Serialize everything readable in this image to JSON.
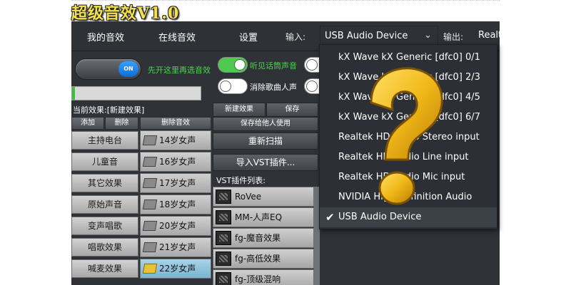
{
  "app": {
    "title": "超级音效V1.0",
    "menu": {
      "tabs": [
        "我的音效",
        "在线音效",
        "设置"
      ],
      "input_label": "输入:",
      "output_label": "输出:",
      "selected_input": "USB Audio Device",
      "output_value": "Realte"
    },
    "left_panel": {
      "toggle_state": "ON",
      "hint": "先开这里再选音效",
      "current_effect": "当前效果:[新建效果]",
      "buttons": [
        "添加",
        "删除",
        "删除音效"
      ],
      "presets": [
        "主持电台",
        "儿童音",
        "其它效果",
        "原始声音",
        "变声唱歌",
        "唱歌效果",
        "喊麦效果"
      ],
      "voices": [
        "14岁女声",
        "16岁女声",
        "17岁女声",
        "18岁女声",
        "20岁女声",
        "21岁女声",
        "22岁女声"
      ],
      "selected_voice": "22岁女声"
    },
    "toggles": [
      {
        "label": "听见话筒声音",
        "on": true
      },
      {
        "label": "消除歌曲人声",
        "on": false
      }
    ],
    "middle_panel": {
      "new_effect": "新建效果",
      "save": "保存",
      "save_for_others": "保存给他人使用",
      "rescan": "重新扫描",
      "import_vst": "导入VST插件...",
      "vst_list_label": "VST插件列表:",
      "vst_plugins": [
        "RoVee",
        "MM-人声EQ",
        "fg-魔音效果",
        "fg-高低效果",
        "fg-顶级混响"
      ]
    },
    "dropdown": {
      "options": [
        "kX Wave kX Generic [dfc0] 0/1",
        "kX Wave kX Generic [dfc0] 2/3",
        "kX Wave kX Generic [dfc0] 4/5",
        "kX Wave kX Generic [dfc0] 6/7",
        "Realtek HD Audio Stereo input",
        "Realtek HD Audio Line input",
        "Realtek HD Audio Mic input",
        "NVIDIA High Definition Audio",
        "USB Audio Device"
      ],
      "selected": "USB Audio Device",
      "check_glyph": "✔"
    }
  },
  "colors": {
    "title_yellow": "#f3e04a",
    "panel_bg": "#2f3338",
    "hint_green": "#4fd24f",
    "question_mark": "#f0b818"
  }
}
